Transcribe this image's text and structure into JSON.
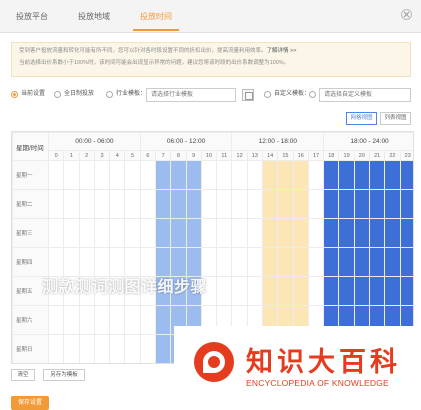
{
  "tabs": [
    {
      "label": "投放平台",
      "active": false
    },
    {
      "label": "投放地域",
      "active": false
    },
    {
      "label": "投放时间",
      "active": true
    }
  ],
  "notice": {
    "line1": "受到客户投放流量和转化可能有所不同，您可以针对各时段设置不同的折扣出价，提高流量利用效率。",
    "link": "了解详情 >>",
    "line2": "当前选择出价系数小于100%时，该时间可能会出现显示异常的问题，建议您将该时段的出价系数调整为100%。"
  },
  "options": {
    "opt1": "当前设置",
    "opt2": "全日制投放",
    "opt3": "行业模板：",
    "industry_placeholder": "请选择行业模板",
    "opt4": "自定义模板：",
    "custom_placeholder": "请选择自定义模板",
    "selected": "opt1"
  },
  "views": {
    "grid": "网格视图",
    "list": "列表视图",
    "active": "grid"
  },
  "grid": {
    "corner": "星期/时间",
    "periods": [
      "00:00 - 06:00",
      "06:00 - 12:00",
      "12:00 - 18:00",
      "18:00 - 24:00"
    ],
    "hours": [
      "0",
      "1",
      "2",
      "3",
      "4",
      "5",
      "6",
      "7",
      "8",
      "9",
      "10",
      "11",
      "12",
      "13",
      "14",
      "15",
      "16",
      "17",
      "18",
      "19",
      "20",
      "21",
      "22",
      "23"
    ],
    "days": [
      "星期一",
      "星期二",
      "星期三",
      "星期四",
      "星期五",
      "星期六",
      "星期日"
    ],
    "hour_status": [
      "white",
      "white",
      "white",
      "white",
      "white",
      "white",
      "white",
      "light",
      "light",
      "light",
      "white",
      "white",
      "white",
      "white",
      "yellow",
      "yellow",
      "yellow",
      "white",
      "deep",
      "deep",
      "deep",
      "deep",
      "deep",
      "deep"
    ],
    "legend_colors": {
      "deep": "#3d6fd7",
      "light": "#9cbbef",
      "yellow": "#fde6b5",
      "white": "#ffffff"
    }
  },
  "buttons": {
    "clear": "清空",
    "save_template": "另存为模板",
    "save": "保存设置"
  },
  "overlay": {
    "banner": "测款测词测图详细步骤",
    "logo_zh": "知识大百科",
    "logo_en": "ENCYCLOPEDIA OF KNOWLEDGE"
  },
  "colors": {
    "accent": "#f19a38",
    "link_blue": "#4a85e8",
    "logo_red": "#e53c1f"
  }
}
